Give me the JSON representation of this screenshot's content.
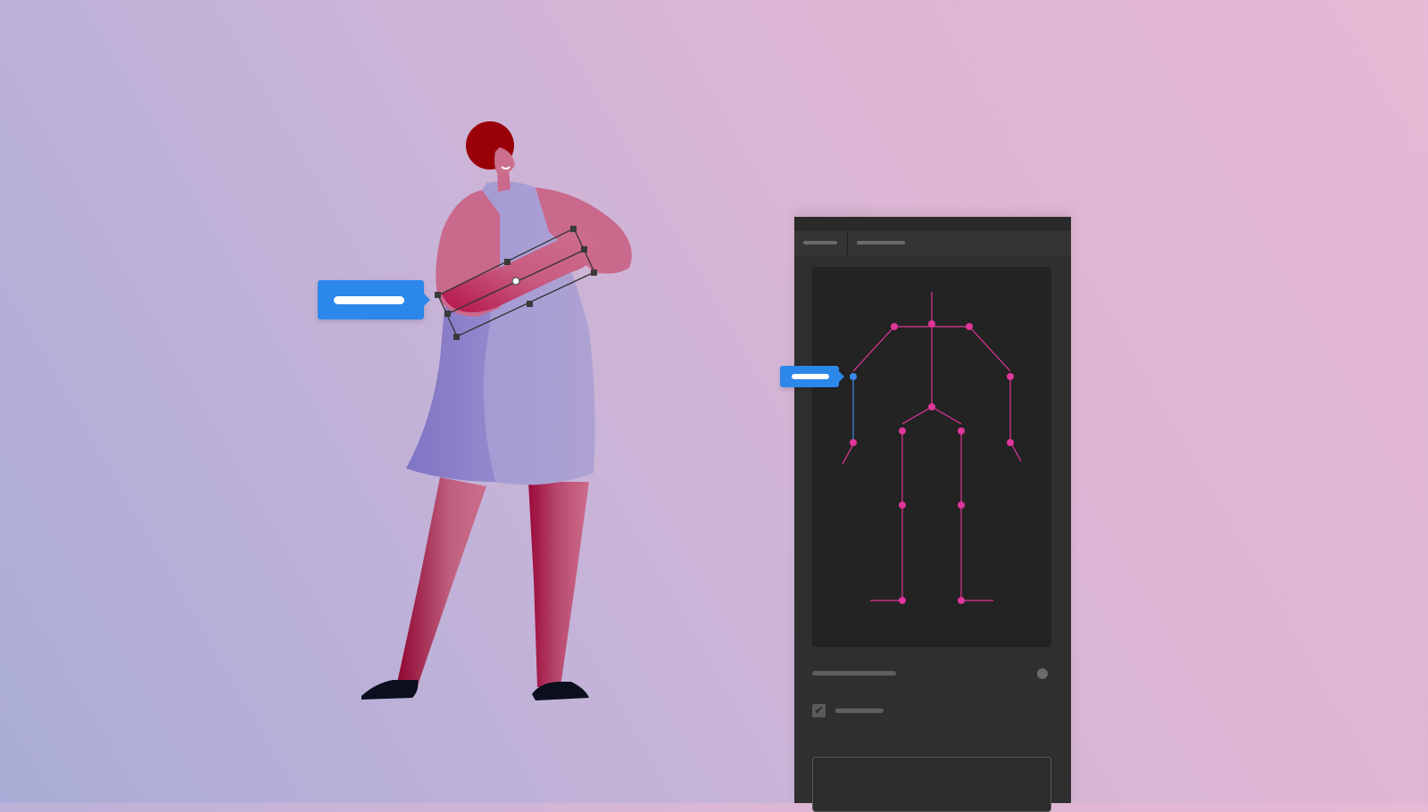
{
  "canvas": {
    "selected_part": "forearm",
    "callout_left": "",
    "callout_right": ""
  },
  "panel": {
    "tabs": [
      {
        "label": ""
      },
      {
        "label": ""
      }
    ],
    "rig_view": {
      "selected_joint": "left-elbow",
      "colors": {
        "bone": "#e0359a",
        "joint": "#e0359a",
        "selected": "#3b87ea",
        "background": "#232323"
      }
    },
    "options": {
      "toggle_label": "",
      "checkbox_label": "",
      "checkbox_checked": true,
      "text_area_value": ""
    }
  },
  "icons": {
    "checkmark": "✔"
  },
  "colors": {
    "accent": "#2b87ea",
    "panel_bg": "#2f2f2f",
    "bone_pink": "#e0359a",
    "hair": "#9a0008",
    "skin": "#c8688a",
    "dress": "#a79bd0"
  }
}
